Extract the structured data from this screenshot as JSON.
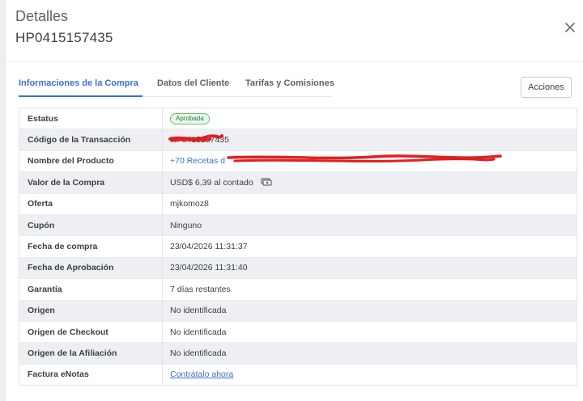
{
  "modal": {
    "title": "Detalles",
    "subtitle": "HP0415157435"
  },
  "tabs": [
    {
      "label": "Informaciones de la Compra",
      "active": true
    },
    {
      "label": "Datos del Cliente",
      "active": false
    },
    {
      "label": "Tarifas y Comisiones",
      "active": false
    }
  ],
  "actions_label": "Acciones",
  "rows": [
    {
      "label": "Estatus",
      "value": "Aprobada"
    },
    {
      "label": "Código de la Transacción",
      "value": "HP0415157435"
    },
    {
      "label": "Nombre del Producto",
      "value": "+70 Recetas d"
    },
    {
      "label": "Valor de la Compra",
      "value": "USD$ 6,39 al contado"
    },
    {
      "label": "Oferta",
      "value": "mjkomoz8"
    },
    {
      "label": "Cupón",
      "value": "Ninguno"
    },
    {
      "label": "Fecha de compra",
      "value": "23/04/2026 11:31:37"
    },
    {
      "label": "Fecha de Aprobación",
      "value": "23/04/2026 11:31:40"
    },
    {
      "label": "Garantía",
      "value": "7 días restantes"
    },
    {
      "label": "Origen",
      "value": "No identificada"
    },
    {
      "label": "Origen de Checkout",
      "value": "No identificada"
    },
    {
      "label": "Origen de la Afiliación",
      "value": "No identificada"
    },
    {
      "label": "Factura eNotas",
      "value": "Contrátalo ahora"
    }
  ],
  "icons": {
    "close": "close-icon",
    "cash": "cash-icon"
  },
  "colors": {
    "accent": "#3b6fd8",
    "status_green": "#2e7d32",
    "redaction": "#e02020"
  }
}
